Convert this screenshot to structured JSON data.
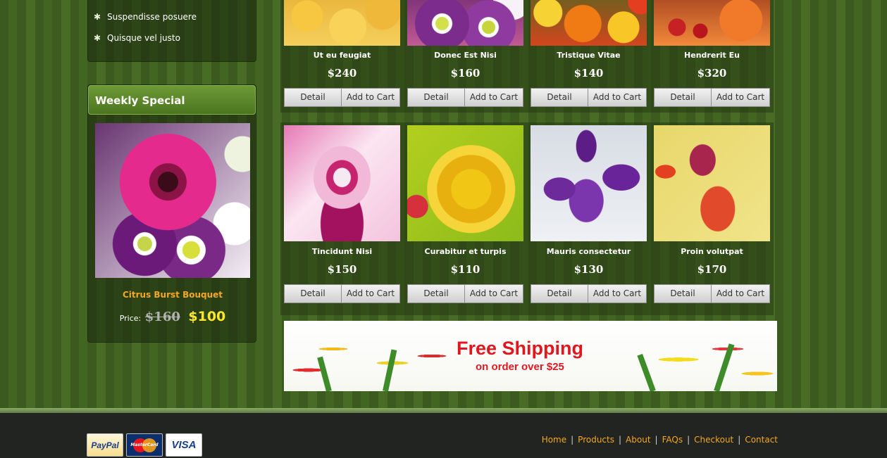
{
  "sidebar": {
    "categories": [
      {
        "label": "Suspendisse posuere",
        "icon": "star-bullet-icon"
      },
      {
        "label": "Quisque vel justo",
        "icon": "star-bullet-icon"
      }
    ],
    "weekly_special": {
      "title": "Weekly Special",
      "product_name": "Citrus Burst Bouquet",
      "price_label": "Price:",
      "old_price": "$160",
      "new_price": "$100"
    }
  },
  "products": [
    {
      "name": "Ut eu feugiat",
      "price": "$240"
    },
    {
      "name": "Donec Est Nisi",
      "price": "$160"
    },
    {
      "name": "Tristique Vitae",
      "price": "$140"
    },
    {
      "name": "Hendrerit Eu",
      "price": "$320"
    },
    {
      "name": "Tincidunt Nisi",
      "price": "$150"
    },
    {
      "name": "Curabitur et turpis",
      "price": "$110"
    },
    {
      "name": "Mauris consectetur",
      "price": "$130"
    },
    {
      "name": "Proin volutpat",
      "price": "$170"
    }
  ],
  "buttons": {
    "detail": "Detail",
    "add_to_cart": "Add to Cart"
  },
  "banner": {
    "title": "Free Shipping",
    "subtitle": "on order over $25"
  },
  "footer": {
    "payment_methods": [
      "PayPal",
      "MasterCard",
      "VISA"
    ],
    "nav": [
      "Home",
      "Products",
      "About",
      "FAQs",
      "Checkout",
      "Contact"
    ],
    "separator": "|"
  },
  "colors": {
    "accent": "#f5a623",
    "price_highlight": "#ffe62e",
    "header_green": "#5a8a2b",
    "footer_bg": "#212420"
  }
}
